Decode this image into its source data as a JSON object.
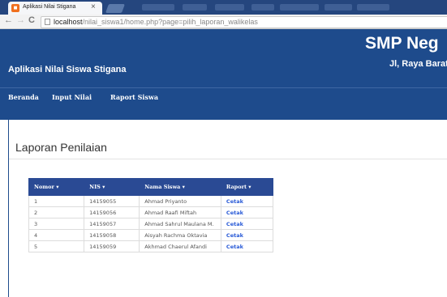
{
  "browser": {
    "tab_title": "Aplikasi Nilai Stigana",
    "tab_close": "×",
    "url_host": "localhost",
    "url_path": "/nilai_siswa1/home.php?page=pilih_laporan_walikelas"
  },
  "header": {
    "app_title": "Aplikasi Nilai Siswa Stigana",
    "school_name": "SMP Neg",
    "school_address": "Jl, Raya Barat I"
  },
  "nav": {
    "items": [
      {
        "label": "Beranda"
      },
      {
        "label": "Input Nilai"
      },
      {
        "label": "Raport Siswa"
      }
    ]
  },
  "main": {
    "heading": "Laporan Penilaian",
    "table": {
      "columns": [
        "Nomor",
        "NIS",
        "Nama Siswa",
        "Raport"
      ],
      "rows": [
        {
          "no": "1",
          "nis": "14159055",
          "name": "Ahmad Priyanto",
          "action": "Cetak"
        },
        {
          "no": "2",
          "nis": "14159056",
          "name": "Ahmad Raafi Miftah",
          "action": "Cetak"
        },
        {
          "no": "3",
          "nis": "14159057",
          "name": "Ahmad Sahrul Maulana M.",
          "action": "Cetak"
        },
        {
          "no": "4",
          "nis": "14159058",
          "name": "Aisyah Rachma Oktavia",
          "action": "Cetak"
        },
        {
          "no": "5",
          "nis": "14159059",
          "name": "Akhmad Chaerul Afandi",
          "action": "Cetak"
        }
      ]
    }
  },
  "colors": {
    "header_bg": "#1e4b8c",
    "table_header_bg": "#2a4a94",
    "link": "#2a5bd7"
  }
}
